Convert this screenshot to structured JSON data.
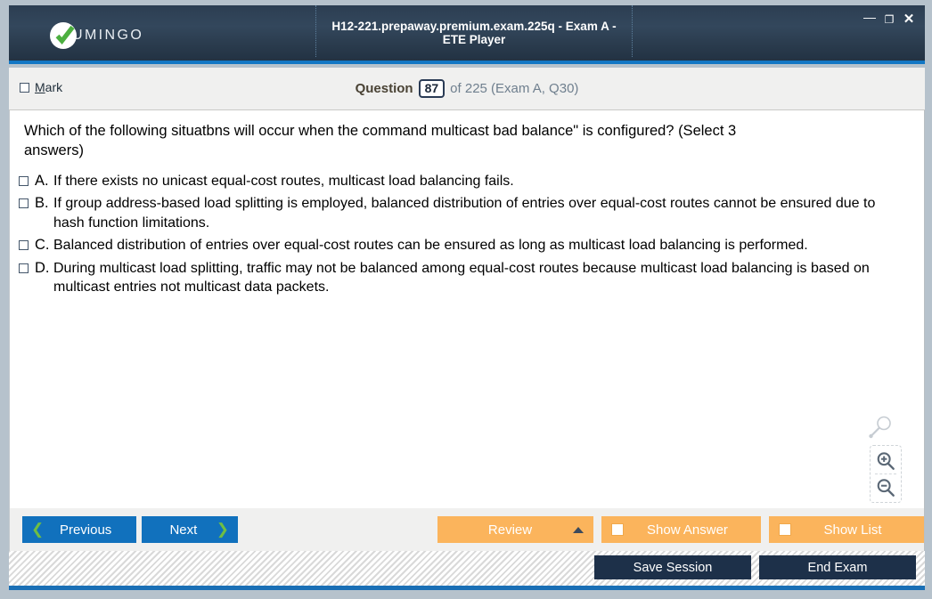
{
  "window": {
    "title": "H12-221.prepaway.premium.exam.225q - Exam A - ETE Player",
    "brand_name": "UMINGO",
    "controls": {
      "minimize": "—",
      "maximize": "❐",
      "close": "✕"
    },
    "accent_blue": "#1277c4",
    "titlebar_bg": "#2c3e52"
  },
  "header": {
    "mark_label_prefix": "",
    "mark_label": "Mark",
    "mark_mnemonic": "M",
    "mark_checked": false,
    "counter_word": "Question",
    "counter_number": "87",
    "counter_rest": "of 225 (Exam A, Q30)"
  },
  "question": {
    "stem": "Which of the following situatbns will occur when the command   multicast bad balance\" is configured? (Select 3 answers)",
    "answers": [
      {
        "letter": "A.",
        "text": "If there exists no unicast equal-cost routes, multicast load balancing fails.",
        "checked": false
      },
      {
        "letter": "B.",
        "text": "If group address-based load splitting is employed, balanced distribution of entries over equal-cost routes cannot be ensured due to hash function limitations.",
        "checked": false
      },
      {
        "letter": "C.",
        "text": "Balanced distribution of entries over equal-cost routes can be ensured as long as multicast load balancing is performed.",
        "checked": false
      },
      {
        "letter": "D.",
        "text": "During multicast load splitting, traffic may not be balanced among equal-cost routes  because multicast load balancing is based on multicast entries not multicast data packets.",
        "checked": false
      }
    ]
  },
  "zoom_tools": {
    "handle_icon": "magnifier-icon",
    "zoom_in_icon": "magnifier-plus-icon",
    "zoom_out_icon": "magnifier-minus-icon"
  },
  "actions": {
    "previous_label": "Previous",
    "next_label": "Next",
    "review_label": "Review",
    "show_answer_label": "Show Answer",
    "show_list_label": "Show List",
    "show_answer_checked": false,
    "show_list_checked": false,
    "button_blue": "#1171bd",
    "chevron_green": "#6fbe44",
    "button_orange": "#fbb45c"
  },
  "status": {
    "save_session_label": "Save Session",
    "end_exam_label": "End Exam",
    "button_dark": "#1d3049",
    "bottom_rule": "#1a6fb5"
  }
}
